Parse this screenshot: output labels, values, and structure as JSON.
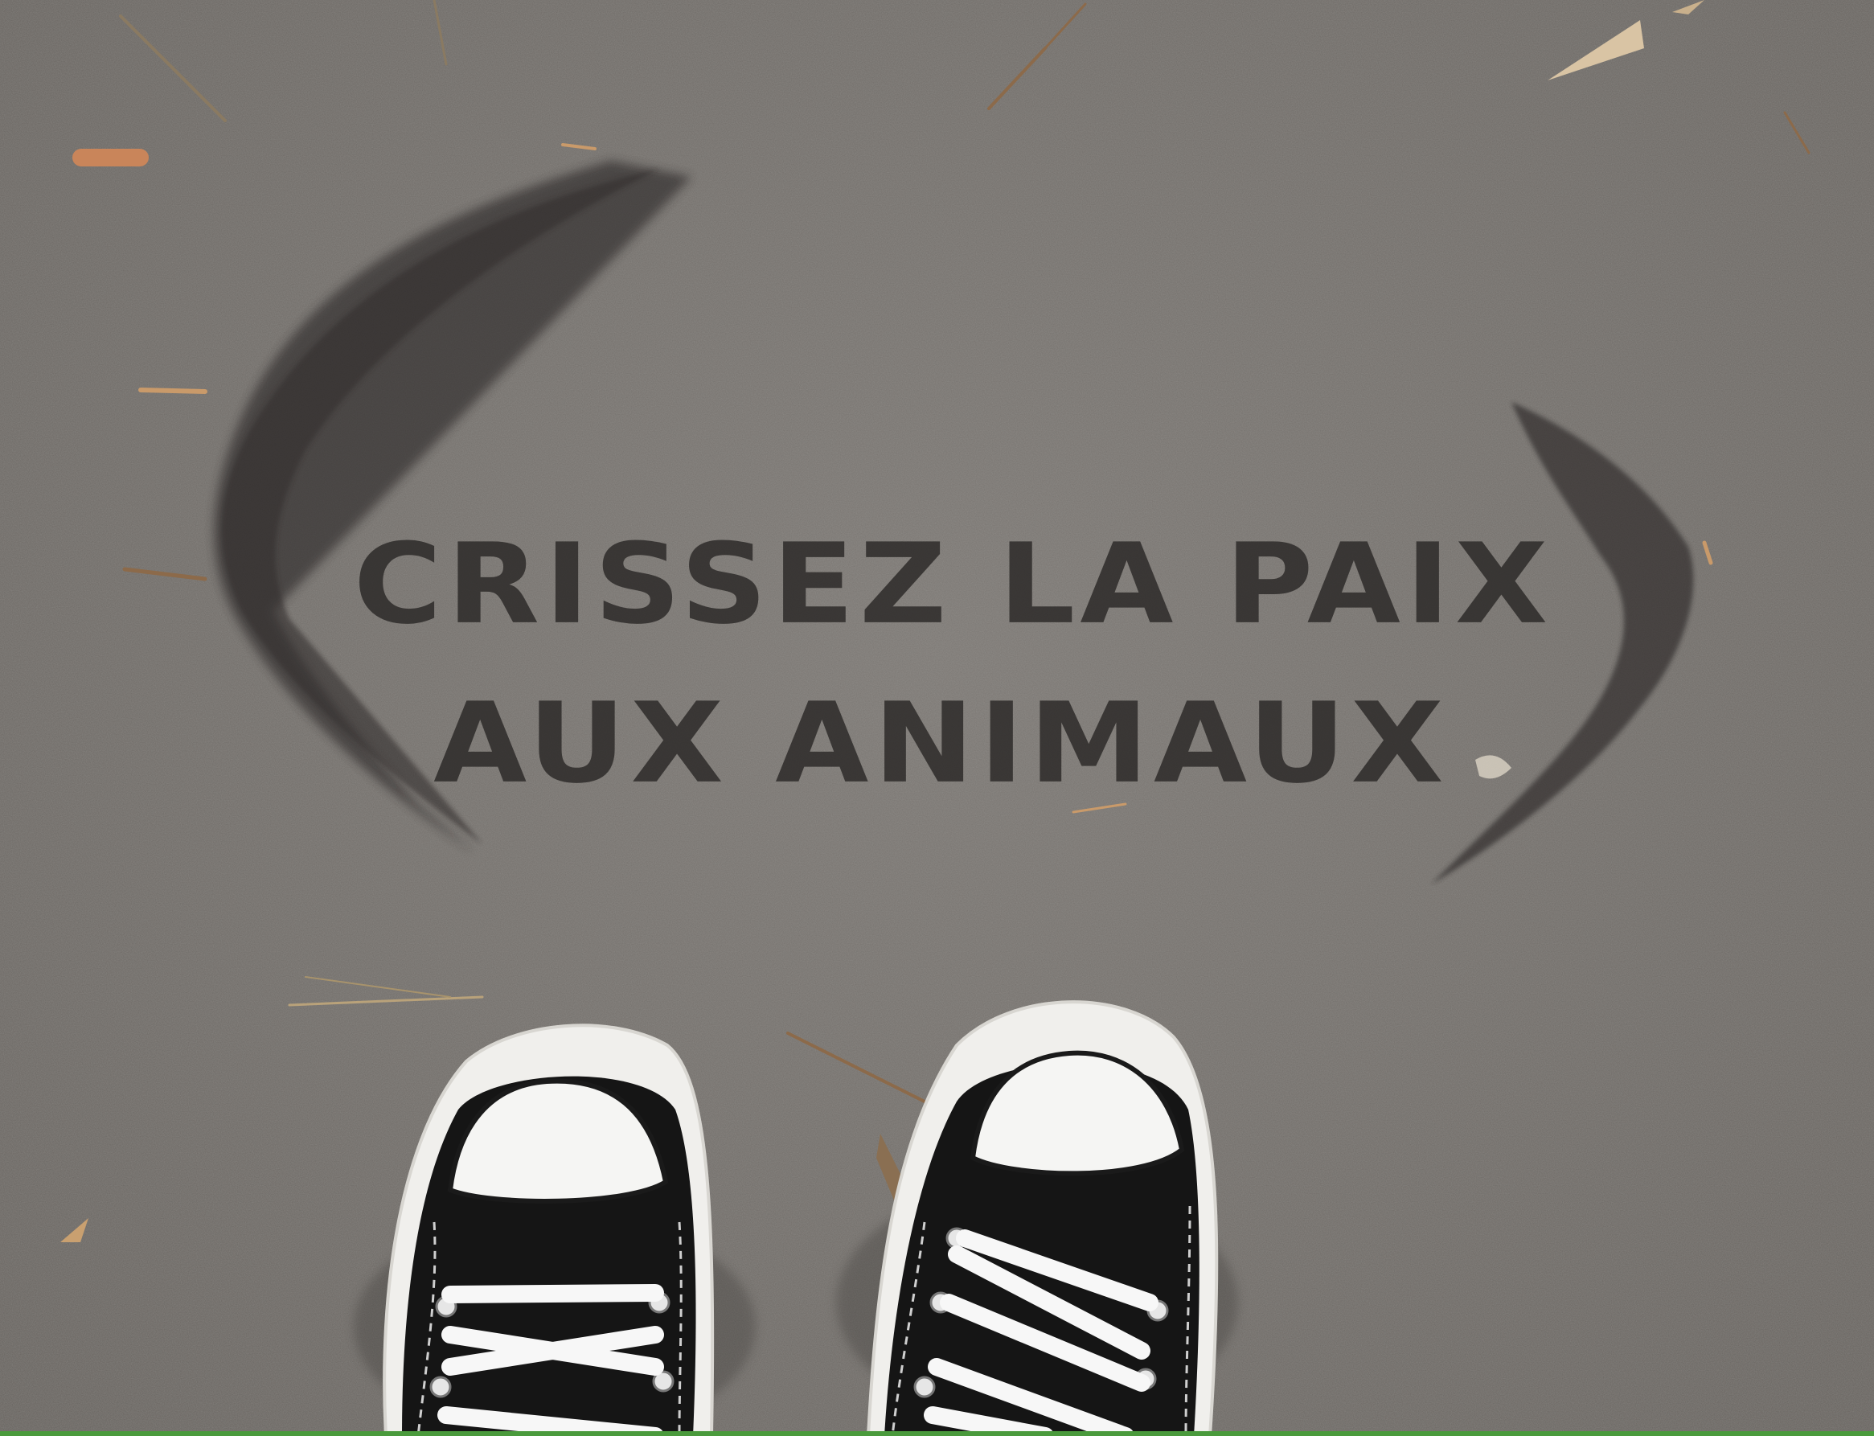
{
  "photo": {
    "subject": "sidewalk-stencil",
    "stencil": {
      "line1": "CRISSEZ LA PAIX",
      "line2": "AUX ANIMAUX"
    },
    "colors": {
      "concrete": "#736f6b",
      "paint": "#2a2826",
      "shoe_canvas": "#141414",
      "shoe_rubber": "#f2f2f0",
      "lace": "#f7f7f7"
    }
  }
}
